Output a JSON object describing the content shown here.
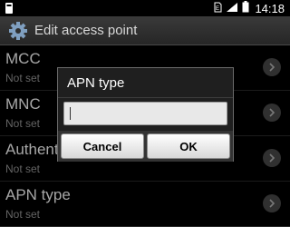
{
  "status_bar": {
    "time": "14:18"
  },
  "app_bar": {
    "title": "Edit access point",
    "icon": "gear-icon"
  },
  "rows": [
    {
      "label": "MCC",
      "value": "Not set"
    },
    {
      "label": "MNC",
      "value": "Not set"
    },
    {
      "label": "Authent",
      "value": "Not set"
    },
    {
      "label": "APN type",
      "value": "Not set"
    }
  ],
  "dialog": {
    "title": "APN type",
    "input_value": "",
    "cancel_label": "Cancel",
    "ok_label": "OK"
  }
}
